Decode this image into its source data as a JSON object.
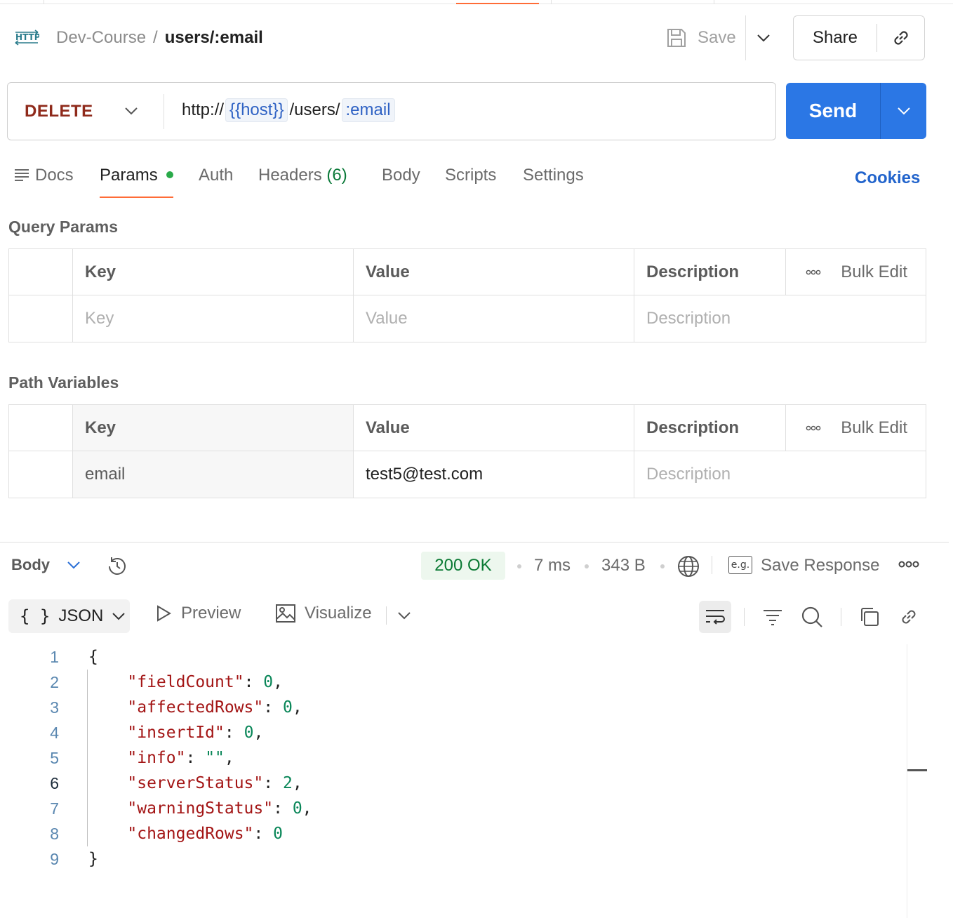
{
  "header": {
    "collection": "Dev-Course",
    "separator": "/",
    "request_name": "users/:email",
    "save_label": "Save",
    "share_label": "Share"
  },
  "request": {
    "method": "DELETE",
    "method_color": "#8f2a1b",
    "url_prefix": "http://",
    "url_var_host": "{{host}}",
    "url_path": "/users/",
    "url_var_email": ":email",
    "send_label": "Send",
    "send_color": "#2b77e5"
  },
  "tabs": {
    "docs": "Docs",
    "params": "Params",
    "auth": "Auth",
    "headers": "Headers",
    "headers_count": "(6)",
    "body": "Body",
    "scripts": "Scripts",
    "settings": "Settings",
    "cookies": "Cookies"
  },
  "query_params": {
    "title": "Query Params",
    "columns": [
      "Key",
      "Value",
      "Description"
    ],
    "bulk_edit": "Bulk Edit",
    "row": {
      "key_placeholder": "Key",
      "value_placeholder": "Value",
      "description_placeholder": "Description"
    }
  },
  "path_variables": {
    "title": "Path Variables",
    "columns": [
      "Key",
      "Value",
      "Description"
    ],
    "bulk_edit": "Bulk Edit",
    "row": {
      "key": "email",
      "value": "test5@test.com",
      "description_placeholder": "Description"
    }
  },
  "response": {
    "body_label": "Body",
    "status": "200 OK",
    "status_color": "#0b7a34",
    "time": "7 ms",
    "size": "343 B",
    "eg_label": "e.g.",
    "save_response": "Save Response",
    "format": "JSON",
    "format_brace": "{ }",
    "preview": "Preview",
    "visualize": "Visualize"
  },
  "json_lines": [
    {
      "num": "1",
      "indent": "",
      "key": "",
      "value": "",
      "punct": "{"
    },
    {
      "num": "2",
      "indent": "    ",
      "key": "\"fieldCount\"",
      "sep": ": ",
      "value": "0",
      "punct": ","
    },
    {
      "num": "3",
      "indent": "    ",
      "key": "\"affectedRows\"",
      "sep": ": ",
      "value": "0",
      "punct": ","
    },
    {
      "num": "4",
      "indent": "    ",
      "key": "\"insertId\"",
      "sep": ": ",
      "value": "0",
      "punct": ","
    },
    {
      "num": "5",
      "indent": "    ",
      "key": "\"info\"",
      "sep": ": ",
      "value": "\"\"",
      "punct": ","
    },
    {
      "num": "6",
      "indent": "    ",
      "key": "\"serverStatus\"",
      "sep": ": ",
      "value": "2",
      "punct": ","
    },
    {
      "num": "7",
      "indent": "    ",
      "key": "\"warningStatus\"",
      "sep": ": ",
      "value": "0",
      "punct": ","
    },
    {
      "num": "8",
      "indent": "    ",
      "key": "\"changedRows\"",
      "sep": ": ",
      "value": "0",
      "punct": ""
    },
    {
      "num": "9",
      "indent": "",
      "key": "",
      "value": "",
      "punct": "}"
    }
  ]
}
